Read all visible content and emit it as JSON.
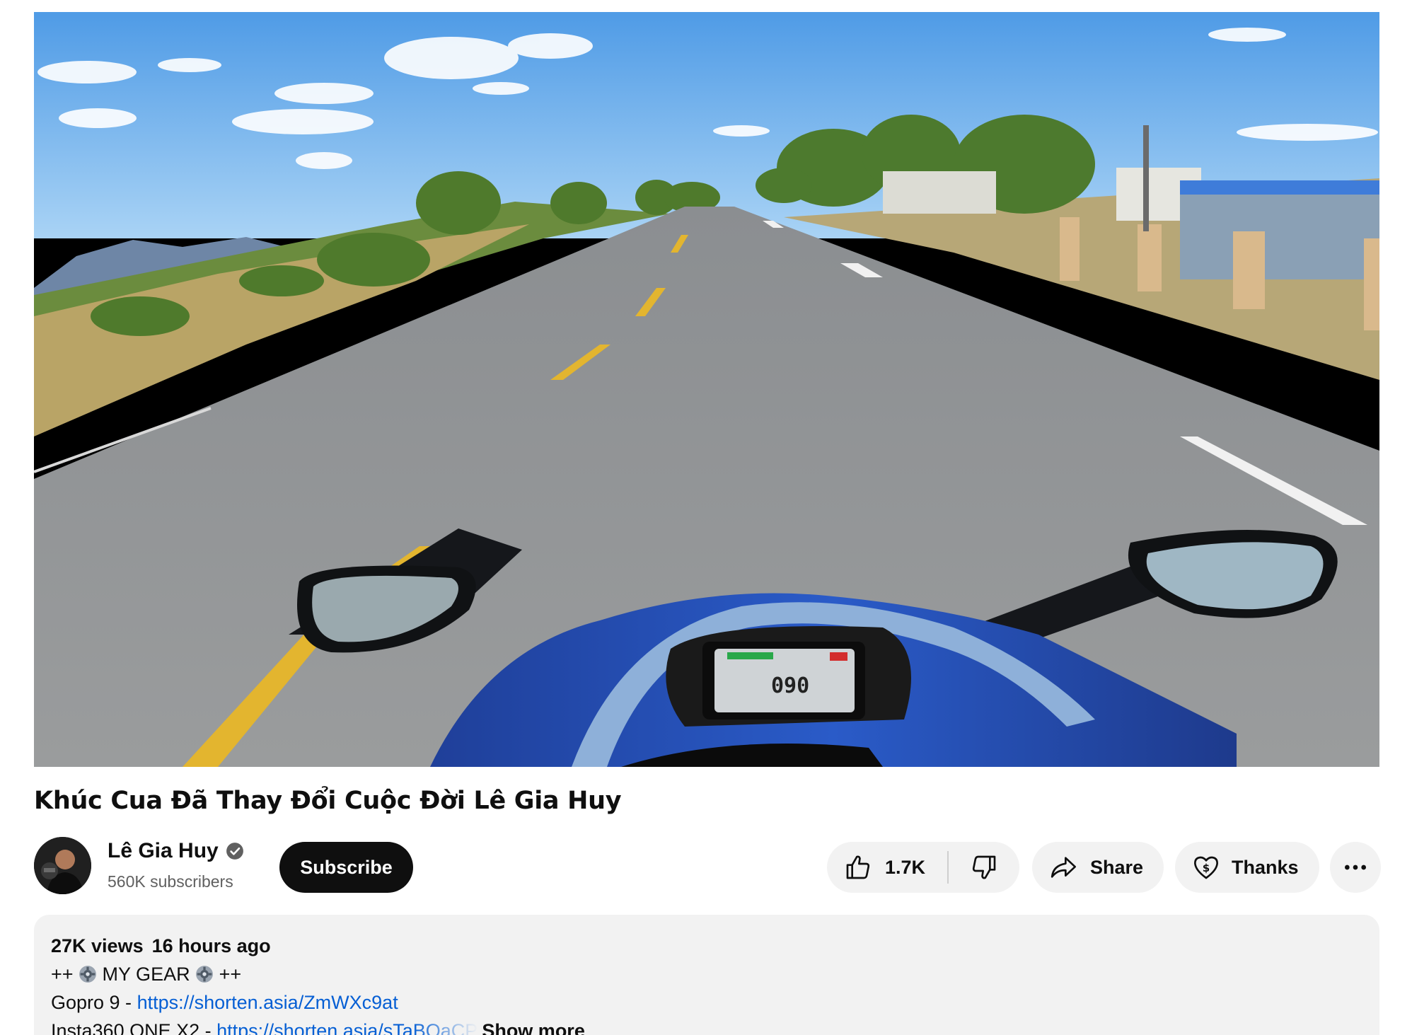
{
  "video": {
    "title": "Khúc Cua Đã Thay Đổi Cuộc Đời Lê Gia Huy",
    "speedometer_reading": "090"
  },
  "channel": {
    "name": "Lê Gia Huy",
    "subscribers": "560K subscribers",
    "verified": true
  },
  "actions": {
    "subscribe_label": "Subscribe",
    "like_count": "1.7K",
    "share_label": "Share",
    "thanks_label": "Thanks"
  },
  "description": {
    "views": "27K views",
    "age": "16 hours ago",
    "lines": [
      {
        "prefix": "++ ",
        "icon": "gear-icon",
        "text": " MY GEAR ",
        "icon2": "gear-icon",
        "suffix": " ++"
      },
      {
        "label": "Gopro 9 - ",
        "link": "https://shorten.asia/ZmWXc9at"
      },
      {
        "label": "Insta360 ONE X2 - ",
        "link": "https://shorten.asia/sTaBQaCP"
      }
    ],
    "show_more_label": "Show more"
  },
  "colors": {
    "link": "#065fd4",
    "pill_bg": "#f2f2f2",
    "subscribe_bg": "#0f0f0f"
  }
}
